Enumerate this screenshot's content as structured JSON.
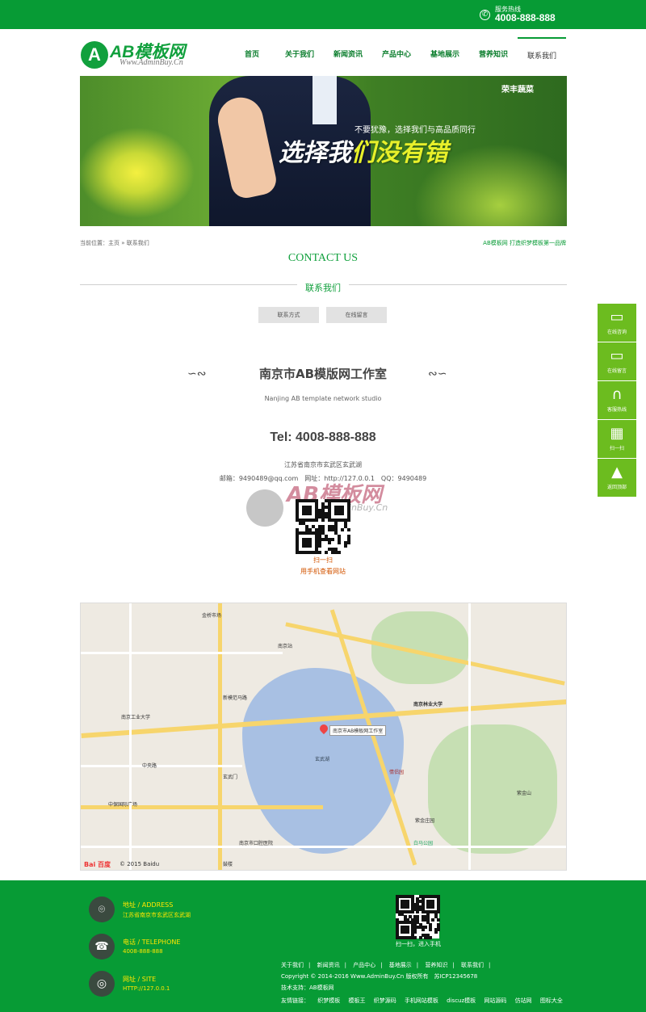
{
  "topbar": {
    "hotline_label": "服务热线",
    "hotline_number": "4008-888-888"
  },
  "logo": {
    "mark": "A",
    "name": "AB模板网",
    "site": "Www.AdminBuy.Cn"
  },
  "nav": [
    "首页",
    "关于我们",
    "新闻资讯",
    "产品中心",
    "基地展示",
    "营养知识",
    "联系我们"
  ],
  "banner": {
    "brand": "荣丰蔬菜",
    "slogan_small": "不要犹豫，选择我们与高品质同行",
    "slogan_big_a": "选择我",
    "slogan_big_b": "们没有错"
  },
  "breadcrumb": {
    "left": "当前位置：主页 » 联系我们",
    "right": "AB模板网 打造织梦模板第一品牌"
  },
  "section": {
    "title_en": "CONTACT US",
    "title_cn": "联系我们"
  },
  "tabs": [
    "联系方式",
    "在线留言"
  ],
  "sidebar": [
    {
      "icon": "chat-icon",
      "label": "在线咨询"
    },
    {
      "icon": "chat-icon",
      "label": "在线留言"
    },
    {
      "icon": "headset-icon",
      "label": "客服热线"
    },
    {
      "icon": "qrcode-icon",
      "label": "扫一扫"
    },
    {
      "icon": "rocket-icon",
      "label": "返回顶部"
    }
  ],
  "studio": {
    "title": "南京市AB模版网工作室",
    "title_en": "Nanjing AB template network studio",
    "tel": "Tel: 4008-888-888",
    "address": "江苏省南京市玄武区玄武湖",
    "contact_row": "邮箱：9490489@qq.com　网址：http://127.0.0.1　QQ：9490489"
  },
  "watermark": {
    "text": "AB模板网",
    "site": "Www.AdminBuy.Cn"
  },
  "qr_caption": {
    "line1": "扫一扫",
    "line2": "用手机查看网站"
  },
  "map": {
    "pin_label": "南京市AB模板网工作室",
    "copyright": "© 2015 Baidu",
    "logo": "Bai 百度",
    "labels": [
      "金桥市场",
      "南京站",
      "新模范马路",
      "南京林业大学",
      "玄武湖",
      "情侣园",
      "玄武门",
      "鼓楼",
      "南京工业大学",
      "中央路",
      "中保国际广场",
      "紫金山",
      "白马公园",
      "南京市口腔医院",
      "紫金庄园"
    ]
  },
  "footer": {
    "address_title": "地址 / ADDRESS",
    "address_value": "江苏省南京市玄武区玄武湖",
    "phone_title": "电话 / TELEPHONE",
    "phone_value": "4008-888-888",
    "site_title": "网址 / SITE",
    "site_value": "HTTP://127.0.0.1",
    "scan_text": "扫一扫，进入手机",
    "links": [
      "关于我们",
      "新闻资讯",
      "产品中心",
      "基地展示",
      "营养知识",
      "联系我们"
    ],
    "copyright": "Copyright © 2014-2016 Www.AdminBuy.Cn 版权所有　苏ICP12345678",
    "tech": "技术支持：AB模板网",
    "friends_label": "友情链接：",
    "friends": [
      "织梦模板",
      "模板王",
      "织梦源码",
      "手机网站模板",
      "discuz模板",
      "网站源码",
      "仿站网",
      "图标大全"
    ]
  }
}
